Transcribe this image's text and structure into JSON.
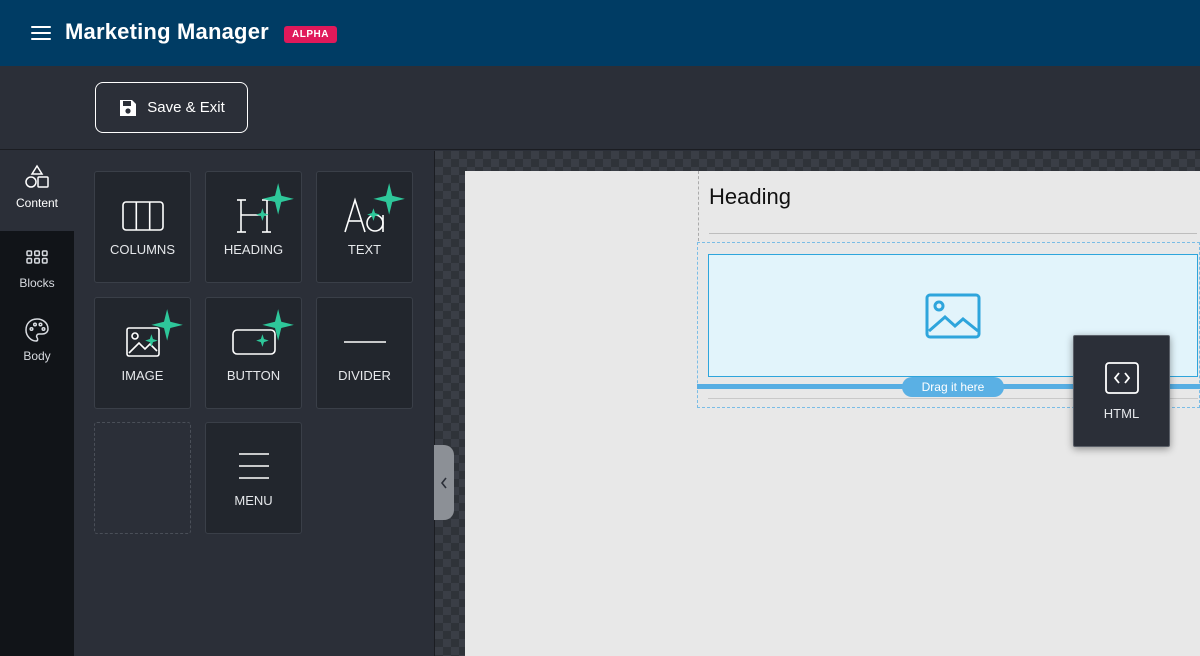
{
  "header": {
    "title": "Marketing Manager",
    "badge": "ALPHA",
    "background_color": "#003c64",
    "badge_color": "#e0195a"
  },
  "toolbar": {
    "save_label": "Save & Exit"
  },
  "rail": {
    "items": [
      {
        "label": "Content",
        "icon": "shapes-icon",
        "active": true
      },
      {
        "label": "Blocks",
        "icon": "grid-dots-icon",
        "active": false
      },
      {
        "label": "Body",
        "icon": "palette-icon",
        "active": false
      }
    ]
  },
  "tiles": [
    {
      "label": "COLUMNS",
      "icon": "columns-icon",
      "sparkle": false
    },
    {
      "label": "HEADING",
      "icon": "heading-icon",
      "sparkle": true
    },
    {
      "label": "TEXT",
      "icon": "text-icon",
      "sparkle": true
    },
    {
      "label": "IMAGE",
      "icon": "image-icon",
      "sparkle": true
    },
    {
      "label": "BUTTON",
      "icon": "button-icon",
      "sparkle": true
    },
    {
      "label": "DIVIDER",
      "icon": "divider-icon",
      "sparkle": false
    },
    {
      "label": "",
      "icon": "",
      "sparkle": false
    },
    {
      "label": "MENU",
      "icon": "menu-icon",
      "sparkle": false
    }
  ],
  "canvas": {
    "heading_text": "Heading",
    "drop_hint": "Drag it here",
    "accent_color": "#2ea5dc"
  },
  "dragging": {
    "label": "HTML",
    "icon": "code-icon"
  }
}
